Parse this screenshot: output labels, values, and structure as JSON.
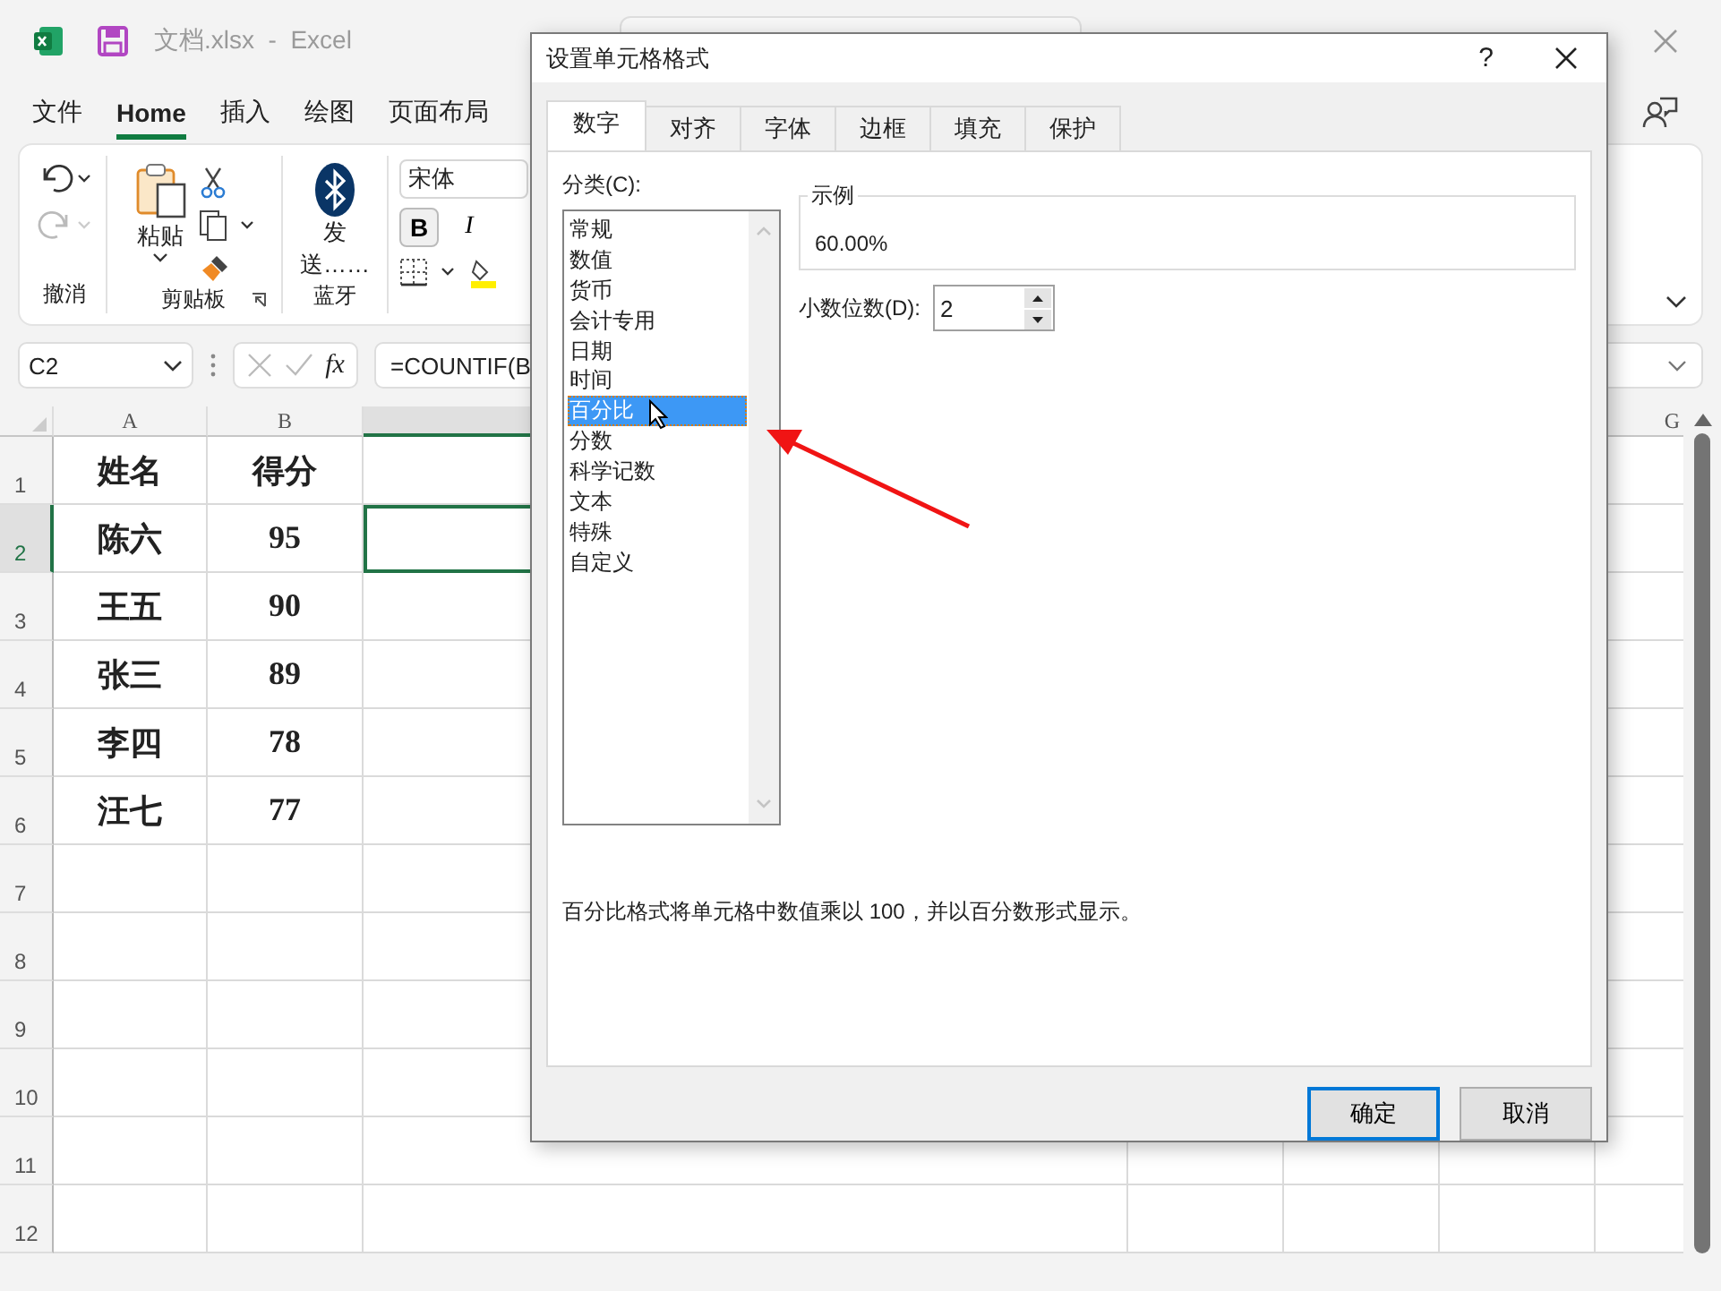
{
  "window": {
    "title": "文档.xlsx  -  Excel"
  },
  "menu": [
    {
      "label": "文件",
      "selected": false
    },
    {
      "label": "Home",
      "selected": true
    },
    {
      "label": "插入",
      "selected": false
    },
    {
      "label": "绘图",
      "selected": false
    },
    {
      "label": "页面布局",
      "selected": false
    }
  ],
  "ribbon": {
    "groups": [
      {
        "kind": "undo",
        "label": "撤消",
        "redo_disabled": true
      },
      {
        "kind": "clipboard",
        "label": "剪贴板",
        "paste": "粘贴"
      },
      {
        "kind": "bluetooth",
        "label": "蓝牙",
        "button": "发送……"
      },
      {
        "kind": "font",
        "font_name": "宋体",
        "bold": {
          "label": "B",
          "on": true
        },
        "italic": {
          "label": "I",
          "on": false
        }
      }
    ]
  },
  "formula_bar": {
    "name_box": "C2",
    "fx": "fx",
    "formula": "=COUNTIF(B"
  },
  "sheet": {
    "columns": [
      {
        "label": "A"
      },
      {
        "label": "B"
      }
    ],
    "right_column": "G",
    "rows": [
      {
        "label": "1",
        "selected": false,
        "cells": [
          "姓名",
          "得分"
        ]
      },
      {
        "label": "2",
        "selected": true,
        "cells": [
          "陈六",
          "95"
        ]
      },
      {
        "label": "3",
        "selected": false,
        "cells": [
          "王五",
          "90"
        ]
      },
      {
        "label": "4",
        "selected": false,
        "cells": [
          "张三",
          "89"
        ]
      },
      {
        "label": "5",
        "selected": false,
        "cells": [
          "李四",
          "78"
        ]
      },
      {
        "label": "6",
        "selected": false,
        "cells": [
          "汪七",
          "77"
        ]
      },
      {
        "label": "7",
        "selected": false,
        "cells": []
      },
      {
        "label": "8",
        "selected": false,
        "cells": []
      },
      {
        "label": "9",
        "selected": false,
        "cells": []
      },
      {
        "label": "10",
        "selected": false,
        "cells": []
      },
      {
        "label": "11",
        "selected": false,
        "cells": []
      },
      {
        "label": "12",
        "selected": false,
        "cells": []
      }
    ]
  },
  "dialog": {
    "title": "设置单元格格式",
    "help": "?",
    "tabs": [
      {
        "label": "数字",
        "selected": true
      },
      {
        "label": "对齐",
        "selected": false
      },
      {
        "label": "字体",
        "selected": false
      },
      {
        "label": "边框",
        "selected": false
      },
      {
        "label": "填充",
        "selected": false
      },
      {
        "label": "保护",
        "selected": false
      }
    ],
    "category_label": "分类(C):",
    "categories": [
      {
        "label": "常规",
        "selected": false
      },
      {
        "label": "数值",
        "selected": false
      },
      {
        "label": "货币",
        "selected": false
      },
      {
        "label": "会计专用",
        "selected": false
      },
      {
        "label": "日期",
        "selected": false
      },
      {
        "label": "时间",
        "selected": false
      },
      {
        "label": "百分比",
        "selected": true
      },
      {
        "label": "分数",
        "selected": false
      },
      {
        "label": "科学记数",
        "selected": false
      },
      {
        "label": "文本",
        "selected": false
      },
      {
        "label": "特殊",
        "selected": false
      },
      {
        "label": "自定义",
        "selected": false
      }
    ],
    "sample_label": "示例",
    "sample_value": "60.00%",
    "decimals_label": "小数位数(D):",
    "decimals_value": "2",
    "description": "百分比格式将单元格中数值乘以 100，并以百分数形式显示。",
    "buttons": [
      {
        "label": "确定",
        "default": true
      },
      {
        "label": "取消",
        "default": false
      }
    ]
  }
}
